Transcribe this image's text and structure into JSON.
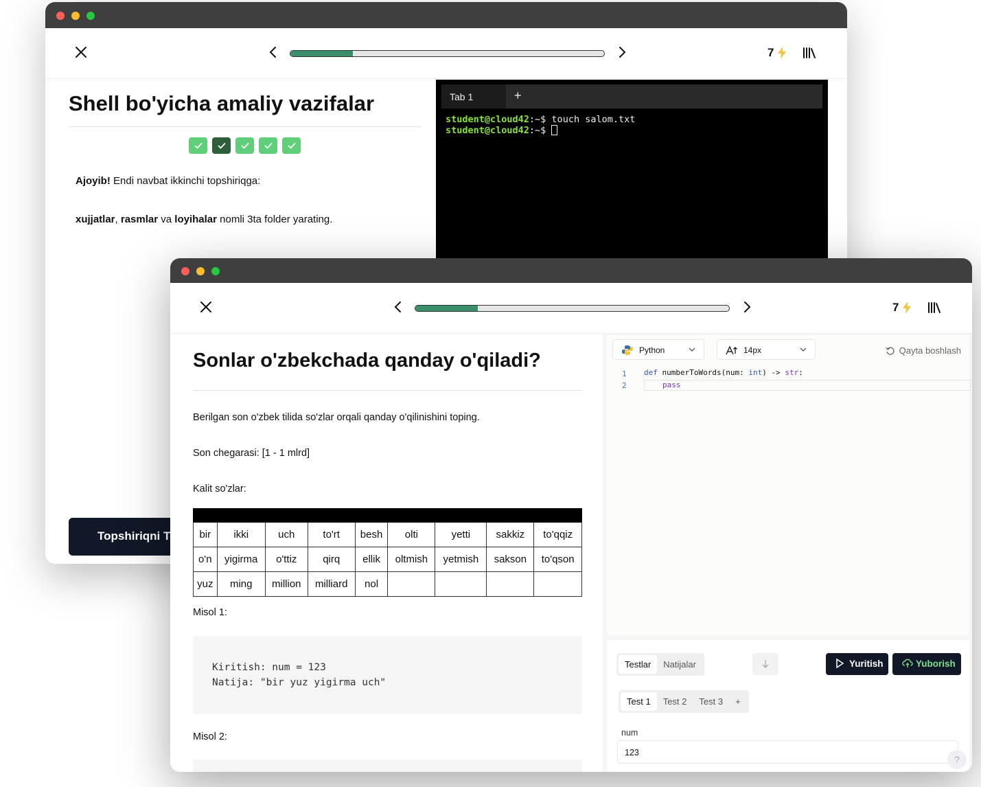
{
  "window1": {
    "topbar": {
      "score": "7",
      "progress_fraction": 0.2
    },
    "title": "Shell bo'yicha amaliy vazifalar",
    "steps": [
      {
        "state": "done"
      },
      {
        "state": "active"
      },
      {
        "state": "done"
      },
      {
        "state": "done"
      },
      {
        "state": "done"
      }
    ],
    "intro_bold": "Ajoyib!",
    "intro_rest": " Endi navbat ikkinchi topshiriqga:",
    "task_parts": [
      "xujjatlar",
      ", ",
      "rasmlar",
      " va ",
      "loyihalar",
      " nomli 3ta folder yarating."
    ],
    "check_button": "Topshiriqni Te",
    "terminal": {
      "tab_label": "Tab 1",
      "add_tab": "+",
      "line1_user": "student@cloud42",
      "line1_rest": ":~$ touch salom.txt",
      "line2_user": "student@cloud42",
      "line2_rest": ":~$ "
    }
  },
  "window2": {
    "topbar": {
      "score": "7",
      "progress_fraction": 0.2
    },
    "title": "Sonlar o'zbekchada qanday o'qiladi?",
    "p1": "Berilgan son o'zbek tilida so'zlar orqali qanday o'qilinishini toping.",
    "p2": "Son chegarasi: [1 - 1 mlrd]",
    "p3": "Kalit so'zlar:",
    "keywords_rows": [
      [
        "bir",
        "ikki",
        "uch",
        "to'rt",
        "besh",
        "olti",
        "yetti",
        "sakkiz",
        "to'qqiz"
      ],
      [
        "o'n",
        "yigirma",
        "o'ttiz",
        "qirq",
        "ellik",
        "oltmish",
        "yetmish",
        "sakson",
        "to'qson"
      ],
      [
        "yuz",
        "ming",
        "million",
        "milliard",
        "nol",
        "",
        "",
        "",
        ""
      ]
    ],
    "example1_label": "Misol 1:",
    "example1_line1": "Kiritish: num = 123",
    "example1_line2": "Natija: \"bir yuz yigirma uch\"",
    "example2_label": "Misol 2:",
    "editor": {
      "language": "Python",
      "font_size": "14px",
      "reset": "Qayta boshlash",
      "line_numbers": [
        "1",
        "2"
      ],
      "code_def": "def",
      "code_name": " numberToWords(num: ",
      "code_int": "int",
      "code_arrow": ") -> ",
      "code_str": "str",
      "code_colon": ":",
      "code_pass": "pass"
    },
    "panel": {
      "tabs": [
        "Testlar",
        "Natijalar"
      ],
      "run": "Yuritish",
      "submit": "Yuborish",
      "tests": [
        "Test 1",
        "Test 2",
        "Test 3",
        "+"
      ],
      "param_label": "num",
      "param_value": "123",
      "help": "?"
    }
  }
}
